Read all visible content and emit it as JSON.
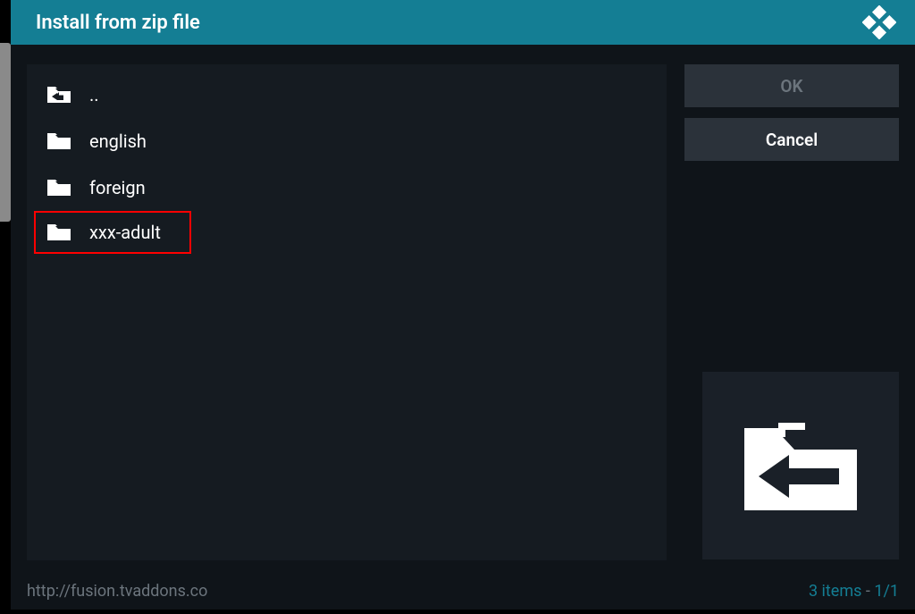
{
  "header": {
    "title": "Install from zip file"
  },
  "files": [
    {
      "type": "up",
      "label": ".."
    },
    {
      "type": "folder",
      "label": "english"
    },
    {
      "type": "folder",
      "label": "foreign"
    },
    {
      "type": "folder",
      "label": "xxx-adult",
      "highlighted": true
    }
  ],
  "buttons": {
    "ok": "OK",
    "cancel": "Cancel"
  },
  "footer": {
    "path": "http://fusion.tvaddons.co",
    "items_text": "3 items",
    "page": "1/1"
  }
}
